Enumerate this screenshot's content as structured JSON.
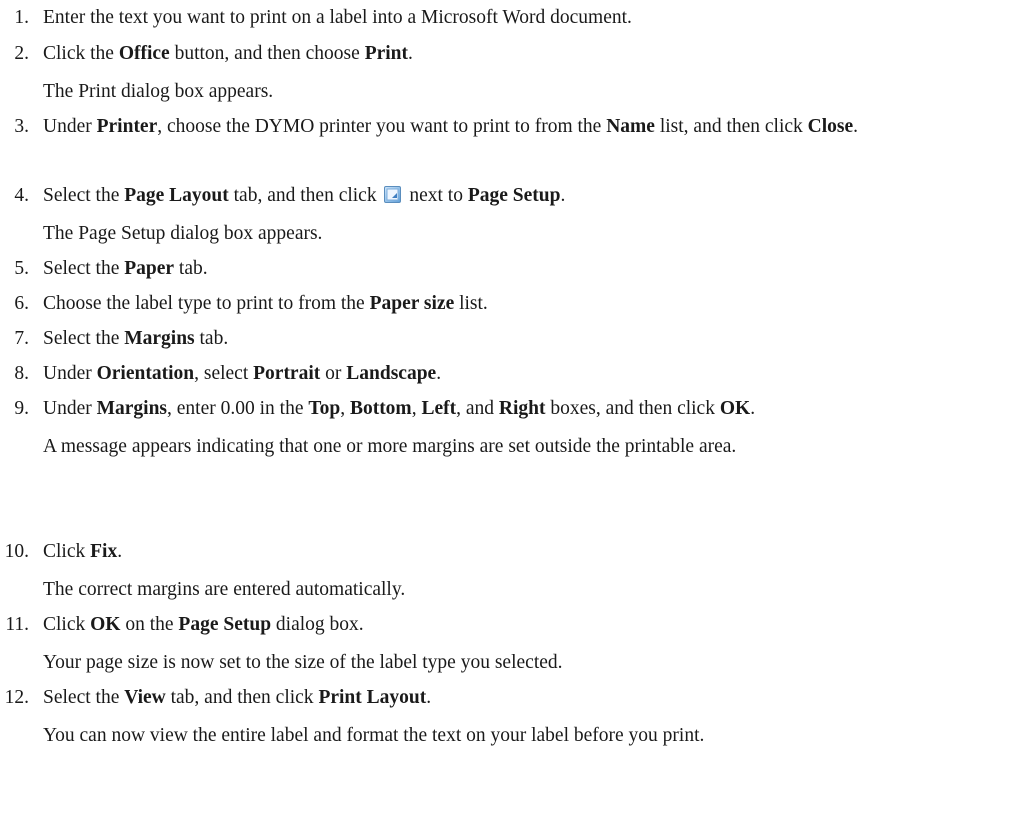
{
  "steps": [
    {
      "number": "1.",
      "parts": [
        "Enter the text you want to print on a label into a Microsoft Word document."
      ]
    },
    {
      "number": "2.",
      "parts": [
        "Click the ",
        "Office",
        " button, and then choose ",
        "Print",
        "."
      ],
      "sub": "The Print dialog box appears."
    },
    {
      "number": "3.",
      "parts": [
        "Under ",
        "Printer",
        ", choose the DYMO printer you want to print to from the ",
        "Name",
        " list, and then click ",
        "Close",
        "."
      ]
    },
    {
      "number": "4.",
      "parts": [
        "Select the ",
        "Page Layout",
        " tab, and then click ",
        " next to ",
        "Page Setup",
        "."
      ],
      "icon": "dialog-launcher-icon",
      "sub": "The Page Setup dialog box appears."
    },
    {
      "number": "5.",
      "parts": [
        "Select the ",
        "Paper",
        " tab."
      ]
    },
    {
      "number": "6.",
      "parts": [
        "Choose the label type to print to from the ",
        "Paper size",
        " list."
      ]
    },
    {
      "number": "7.",
      "parts": [
        "Select the ",
        "Margins",
        " tab."
      ]
    },
    {
      "number": "8.",
      "parts": [
        "Under ",
        "Orientation",
        ", select ",
        "Portrait",
        " or ",
        "Landscape",
        "."
      ]
    },
    {
      "number": "9.",
      "parts": [
        "Under ",
        "Margins",
        ", enter 0.00 in the ",
        "Top",
        ", ",
        "Bottom",
        ", ",
        "Left",
        ", and ",
        "Right",
        " boxes, and then click ",
        "OK",
        "."
      ],
      "sub": "A message appears indicating that one or more margins are set outside the printable area."
    },
    {
      "number": "10.",
      "parts": [
        "Click ",
        "Fix",
        "."
      ],
      "sub": "The correct margins are entered automatically."
    },
    {
      "number": "11.",
      "parts": [
        "Click ",
        "OK",
        " on the ",
        "Page Setup",
        " dialog box."
      ],
      "sub": "Your page size is now set to the size of the label type you selected."
    },
    {
      "number": "12.",
      "parts": [
        "Select the ",
        "View",
        " tab, and then click ",
        "Print Layout",
        "."
      ],
      "sub": "You can now view the entire label and format the text on your label before you print."
    }
  ]
}
